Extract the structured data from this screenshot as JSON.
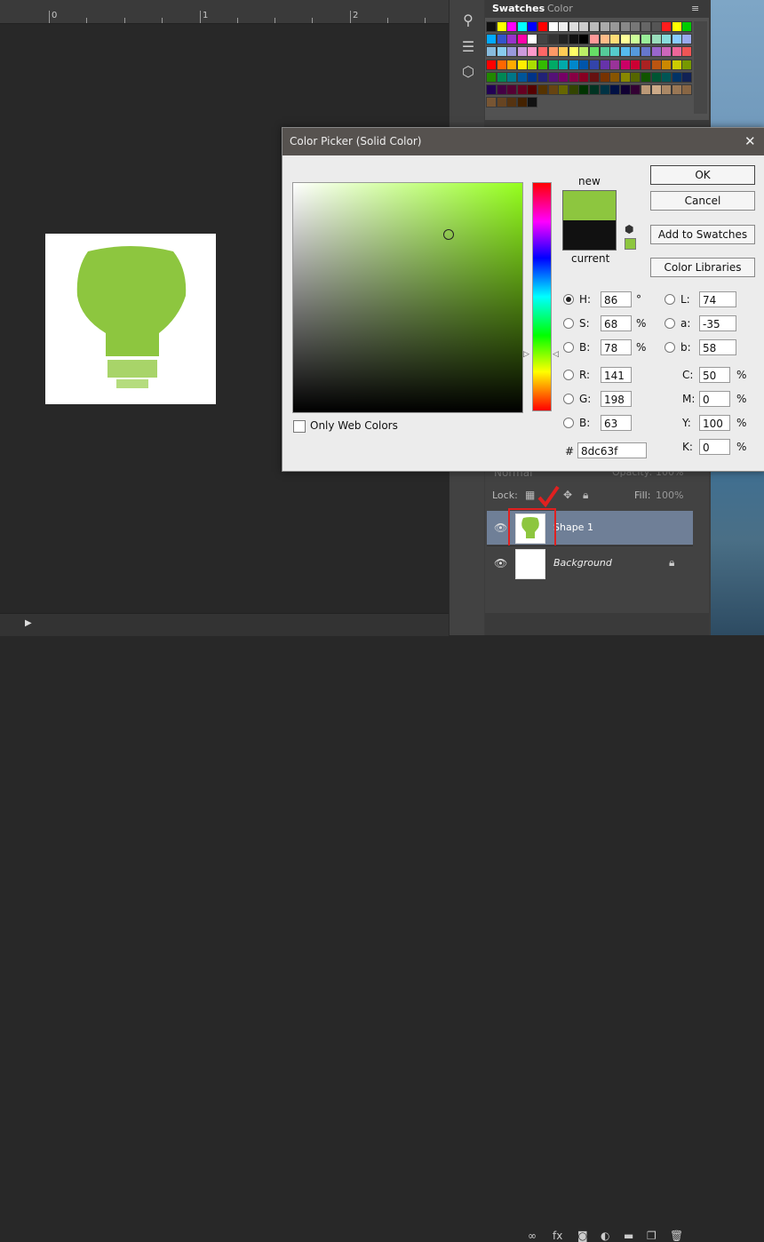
{
  "ruler": {
    "marks": [
      "0",
      "1",
      "2"
    ]
  },
  "panels": {
    "swatches_tab": "Swatches",
    "color_tab": "Color",
    "swatch_colors": [
      [
        "#111111",
        "#ffff00",
        "#ff00ff",
        "#00ffff",
        "#0000ff",
        "#ff0000",
        "#ffffff",
        "#eeeeee",
        "#dddddd",
        "#cccccc",
        "#bbbbbb",
        "#aaaaaa",
        "#999999",
        "#888888",
        "#777777",
        "#666666",
        "#555555",
        "#ff1e1e",
        "#ffff00",
        "#00cc00"
      ],
      [
        "#00aaff",
        "#3355cc",
        "#9933cc",
        "#ff00aa",
        "#ffffff",
        "#444444",
        "#333333",
        "#222222",
        "#111111",
        "#000000",
        "#ff9999",
        "#ffbb88",
        "#ffdd77",
        "#ffff99",
        "#ccff99",
        "#99ee99",
        "#99ddbb",
        "#88dddd",
        "#88ccff",
        "#99aaee"
      ],
      [
        "#88bbdd",
        "#88ccee",
        "#9999dd",
        "#cc99dd",
        "#ff99cc",
        "#ff6666",
        "#ff9966",
        "#ffcc55",
        "#ffff66",
        "#bbee66",
        "#66dd66",
        "#55cc99",
        "#55cccc",
        "#55bbee",
        "#5599dd",
        "#6677cc",
        "#9966cc",
        "#cc66bb",
        "#ee6699",
        "#ee5555"
      ],
      [
        "#ff0000",
        "#ff6600",
        "#ffaa00",
        "#ffee00",
        "#aadd00",
        "#33bb00",
        "#00aa66",
        "#00aaaa",
        "#0088cc",
        "#0055aa",
        "#3344aa",
        "#6633aa",
        "#993399",
        "#cc0066",
        "#cc0033",
        "#aa2222",
        "#bb5511",
        "#cc8800",
        "#cccc00",
        "#779900"
      ],
      [
        "#228800",
        "#008855",
        "#007788",
        "#005599",
        "#003388",
        "#222277",
        "#551177",
        "#770066",
        "#880044",
        "#880022",
        "#661111",
        "#773300",
        "#885500",
        "#888800",
        "#556600",
        "#115500",
        "#005533",
        "#005555",
        "#003366",
        "#112255"
      ],
      [
        "#220055",
        "#440044",
        "#550033",
        "#660022",
        "#550000",
        "#553300",
        "#664411",
        "#666600",
        "#334400",
        "#003300",
        "#003322",
        "#003344",
        "#001144",
        "#110033",
        "#330033",
        "#bb9977",
        "#ccaa88",
        "#aa8866",
        "#997755",
        "#886644"
      ],
      [
        "#775533",
        "#664422",
        "#553311",
        "#442200",
        "#111111"
      ]
    ],
    "layers": {
      "blend_mode": "Normal",
      "opacity_label": "Opacity:",
      "opacity_value": "100%",
      "lock_label": "Lock:",
      "fill_label": "Fill:",
      "fill_value": "100%",
      "layer1_name": "Shape 1",
      "layer2_name": "Background"
    }
  },
  "dialog": {
    "title": "Color Picker (Solid Color)",
    "close": "✕",
    "new_label": "new",
    "current_label": "current",
    "new_color": "#8dc63f",
    "current_color": "#111111",
    "ok": "OK",
    "cancel": "Cancel",
    "add_swatches": "Add to Swatches",
    "color_libraries": "Color Libraries",
    "only_web": "Only Web Colors",
    "fields": {
      "H": {
        "label": "H:",
        "value": "86",
        "unit": "°"
      },
      "S": {
        "label": "S:",
        "value": "68",
        "unit": "%"
      },
      "Bv": {
        "label": "B:",
        "value": "78",
        "unit": "%"
      },
      "R": {
        "label": "R:",
        "value": "141"
      },
      "G": {
        "label": "G:",
        "value": "198"
      },
      "Bl": {
        "label": "B:",
        "value": "63"
      },
      "L": {
        "label": "L:",
        "value": "74"
      },
      "a": {
        "label": "a:",
        "value": "-35"
      },
      "b": {
        "label": "b:",
        "value": "58"
      },
      "C": {
        "label": "C:",
        "value": "50",
        "unit": "%"
      },
      "M": {
        "label": "M:",
        "value": "0",
        "unit": "%"
      },
      "Y": {
        "label": "Y:",
        "value": "100",
        "unit": "%"
      },
      "K": {
        "label": "K:",
        "value": "0",
        "unit": "%"
      }
    },
    "hash": "#",
    "hex": "8dc63f"
  }
}
